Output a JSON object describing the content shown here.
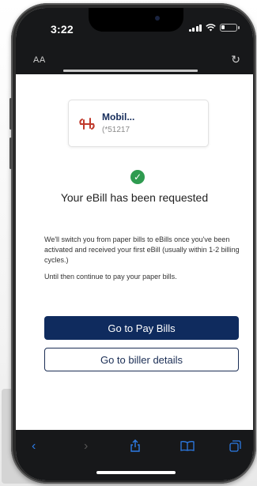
{
  "status_bar": {
    "time": "3:22"
  },
  "url_bar": {
    "text_size_label": "AA",
    "reload_icon": "reload-icon"
  },
  "biller": {
    "name": "Mobil...",
    "account": "(*51217"
  },
  "confirmation": {
    "headline": "Your eBill has been requested",
    "paragraph1": "We'll switch you from paper bills to eBills once you've been activated and received your first eBill (usually within 1-2 billing cycles.)",
    "paragraph2": "Until then continue to pay your paper bills."
  },
  "buttons": {
    "pay_bills": "Go to Pay Bills",
    "biller_details": "Go to biller details"
  },
  "toolbar": {
    "back_icon": "back-chevron-icon",
    "forward_icon": "forward-chevron-icon",
    "share_icon": "share-icon",
    "bookmarks_icon": "bookmarks-icon",
    "tabs_icon": "tabs-icon"
  },
  "colors": {
    "primary_button": "#0f2b5e",
    "success_green": "#2f9b50",
    "toolbar_accent": "#2d7be5"
  }
}
